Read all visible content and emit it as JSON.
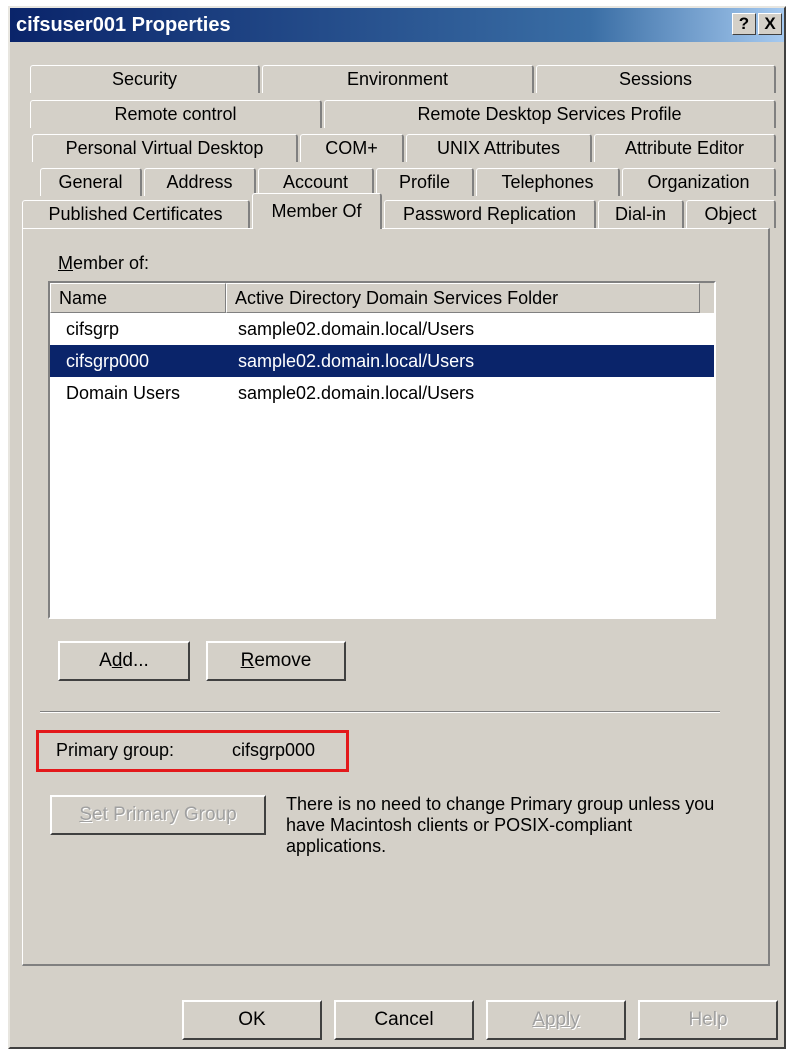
{
  "window": {
    "title": "cifsuser001 Properties",
    "help_btn": "?",
    "close_btn": "X"
  },
  "tabs": {
    "row1": [
      "Security",
      "Environment",
      "Sessions"
    ],
    "row2": [
      "Remote control",
      "Remote Desktop Services Profile"
    ],
    "row3": [
      "Personal Virtual Desktop",
      "COM+",
      "UNIX Attributes",
      "Attribute Editor"
    ],
    "row4": [
      "General",
      "Address",
      "Account",
      "Profile",
      "Telephones",
      "Organization"
    ],
    "row5": [
      "Published Certificates",
      "Member Of",
      "Password Replication",
      "Dial-in",
      "Object"
    ],
    "active": "Member Of"
  },
  "member_of": {
    "label_prefix": "M",
    "label_rest": "ember of:",
    "columns": [
      "Name",
      "Active Directory Domain Services Folder"
    ],
    "rows": [
      {
        "name": "cifsgrp",
        "folder": "sample02.domain.local/Users",
        "selected": false
      },
      {
        "name": "cifsgrp000",
        "folder": "sample02.domain.local/Users",
        "selected": true
      },
      {
        "name": "Domain Users",
        "folder": "sample02.domain.local/Users",
        "selected": false
      }
    ]
  },
  "buttons": {
    "add_pre": "A",
    "add_u": "d",
    "add_post": "d...",
    "remove_u": "R",
    "remove_post": "emove",
    "set_primary_u": "S",
    "set_primary_post": "et Primary Group",
    "ok": "OK",
    "cancel": "Cancel",
    "apply": "Apply",
    "help": "Help"
  },
  "primary_group": {
    "label": "Primary group:",
    "value": "cifsgrp000",
    "note": "There is no need to change Primary group unless you have Macintosh clients or POSIX-compliant applications."
  },
  "colors": {
    "title_start": "#0a246a",
    "selection": "#0a246a",
    "highlight_box": "#e3191b",
    "face": "#d4d0c8"
  }
}
